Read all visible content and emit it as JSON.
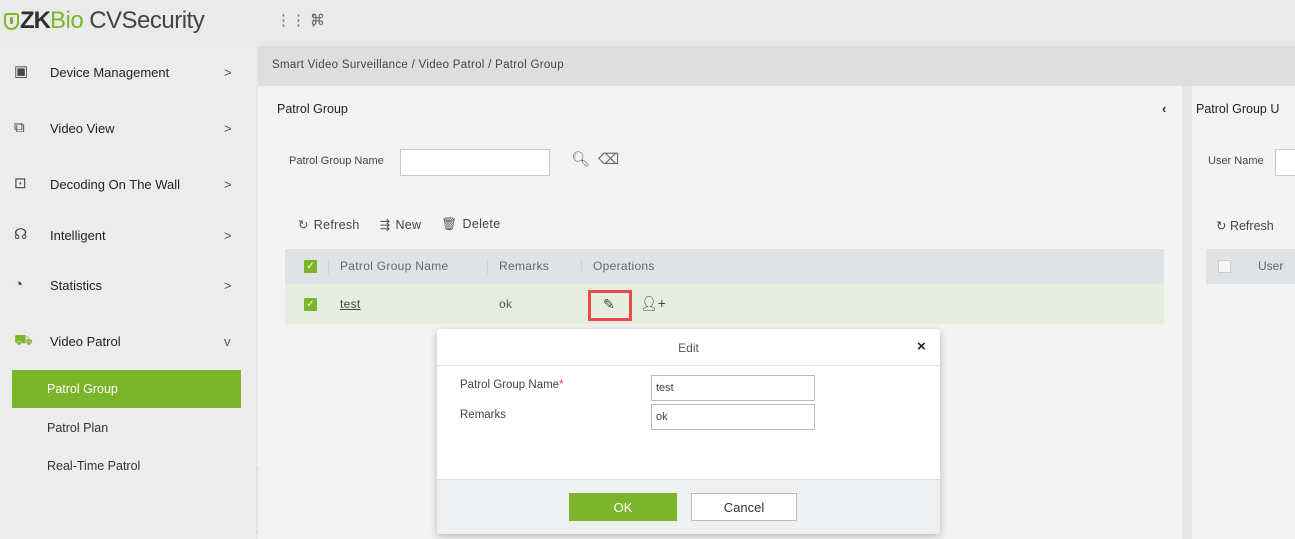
{
  "app": {
    "logo_zk": "ZK",
    "logo_bio": "Bio",
    "logo_cv": "CVSecurity",
    "top_icons": [
      "grid-icon",
      "command-icon"
    ]
  },
  "sidebar": {
    "items": [
      {
        "label": "Device Management",
        "icon": "device-icon",
        "arrow": ">"
      },
      {
        "label": "Video View",
        "icon": "video-view-icon",
        "arrow": ">"
      },
      {
        "label": "Decoding On The Wall",
        "icon": "monitor-icon",
        "arrow": ">"
      },
      {
        "label": "Intelligent",
        "icon": "intelligent-icon",
        "arrow": ">"
      },
      {
        "label": "Statistics",
        "icon": "pie-chart-icon",
        "arrow": ">"
      },
      {
        "label": "Video Patrol",
        "icon": "patrol-icon",
        "arrow": "v"
      }
    ],
    "sub_items": [
      {
        "label": "Patrol Group",
        "active": true
      },
      {
        "label": "Patrol Plan",
        "active": false
      },
      {
        "label": "Real-Time Patrol",
        "active": false
      }
    ],
    "collapse_label": "«"
  },
  "breadcrumb": "Smart Video Surveillance / Video Patrol / Patrol Group",
  "main": {
    "title": "Patrol Group",
    "collapse_glyph": "‹",
    "search": {
      "label": "Patrol Group Name",
      "value": ""
    },
    "toolbar": {
      "refresh": "Refresh",
      "new": "New",
      "delete": "Delete"
    },
    "columns": [
      "Patrol Group Name",
      "Remarks",
      "Operations"
    ],
    "rows": [
      {
        "name": "test",
        "remarks": "ok"
      }
    ]
  },
  "right_panel": {
    "title": "Patrol Group U",
    "search_label": "User Name",
    "refresh": "Refresh",
    "column": "User"
  },
  "modal": {
    "title": "Edit",
    "close": "×",
    "fields": [
      {
        "label": "Patrol Group Name",
        "required": "*",
        "value": "test"
      },
      {
        "label": "Remarks",
        "required": "",
        "value": "ok"
      }
    ],
    "ok": "OK",
    "cancel": "Cancel"
  },
  "colors": {
    "accent": "#7bb52c",
    "highlight": "#e94a4a"
  }
}
